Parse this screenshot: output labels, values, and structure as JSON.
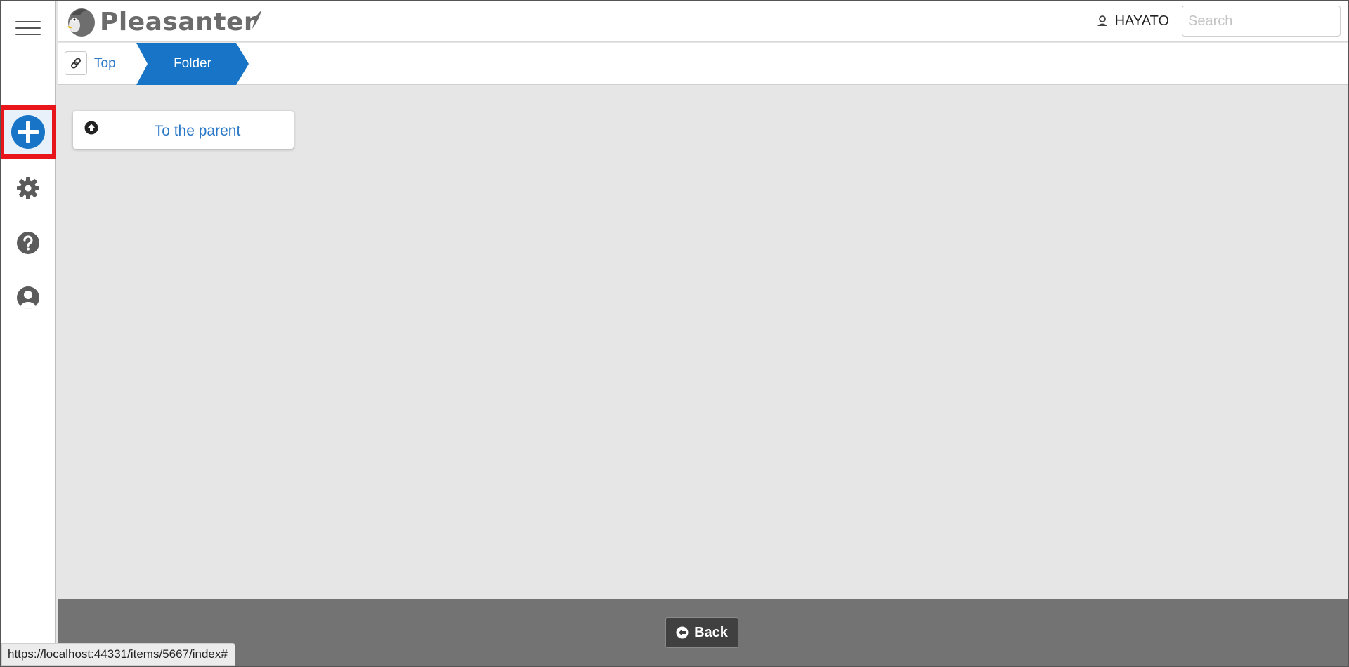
{
  "app": {
    "name": "Pleasanter"
  },
  "sidebar": {
    "items": [
      {
        "name": "menu",
        "icon": "hamburger-icon"
      },
      {
        "name": "add",
        "icon": "plus-circle-icon",
        "highlighted": true
      },
      {
        "name": "settings",
        "icon": "gear-icon"
      },
      {
        "name": "help",
        "icon": "question-circle-icon"
      },
      {
        "name": "account",
        "icon": "user-circle-icon"
      }
    ]
  },
  "header": {
    "user_name": "HAYATO",
    "search_placeholder": "Search",
    "search_value": ""
  },
  "breadcrumb": {
    "items": [
      {
        "label": "Top"
      },
      {
        "label": "Folder",
        "active": true
      }
    ]
  },
  "main": {
    "parent_link_label": "To the parent"
  },
  "footer": {
    "back_label": "Back"
  },
  "status_bar": {
    "url": "https://localhost:44331/items/5667/index#"
  },
  "colors": {
    "accent": "#1774c7",
    "link": "#2a78c8",
    "highlight_border": "#e8161a",
    "content_bg": "#e6e6e6",
    "footer_bg": "#737373"
  }
}
